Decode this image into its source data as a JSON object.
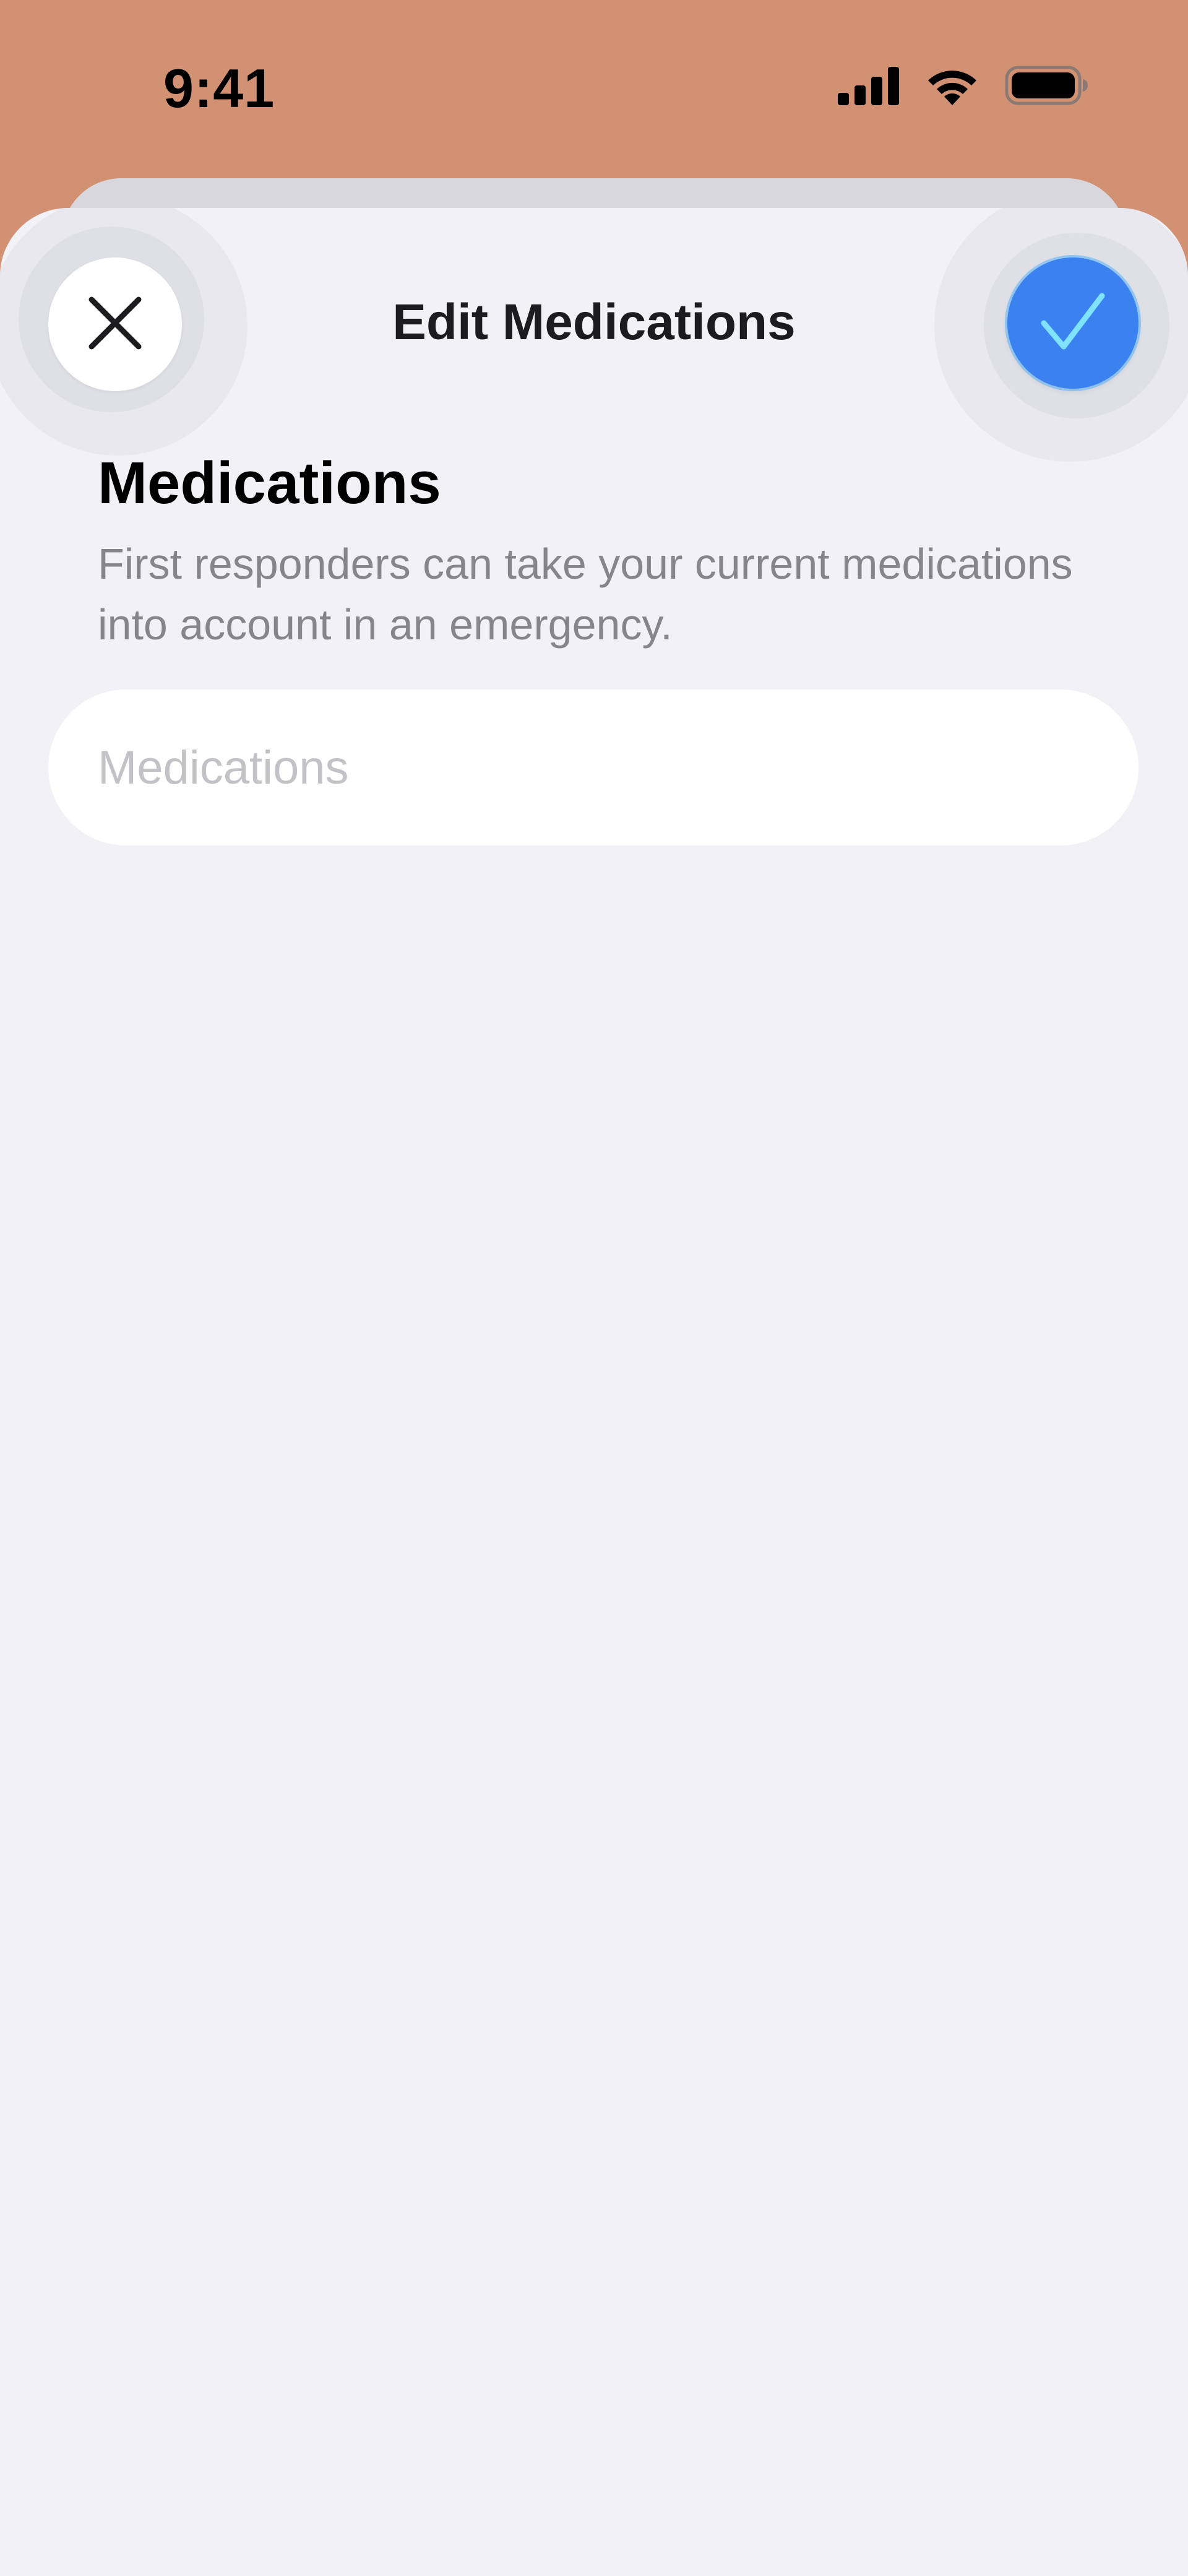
{
  "status_bar": {
    "time": "9:41",
    "icons": [
      "cellular-signal-icon",
      "wifi-icon",
      "battery-icon"
    ]
  },
  "nav": {
    "title": "Edit Medications",
    "close_icon": "close-icon",
    "done_icon": "checkmark-icon"
  },
  "section": {
    "heading": "Medications",
    "description": "First responders can take your current medications into account in an emergency."
  },
  "medications_field": {
    "value": "",
    "placeholder": "Medications"
  },
  "colors": {
    "background": "#D39174",
    "sheet": "#F2F1F6",
    "accent": "#3B82F0",
    "checkmark": "#7FE3FF",
    "secondary_text": "#85858B",
    "placeholder": "#C2C2C7"
  }
}
